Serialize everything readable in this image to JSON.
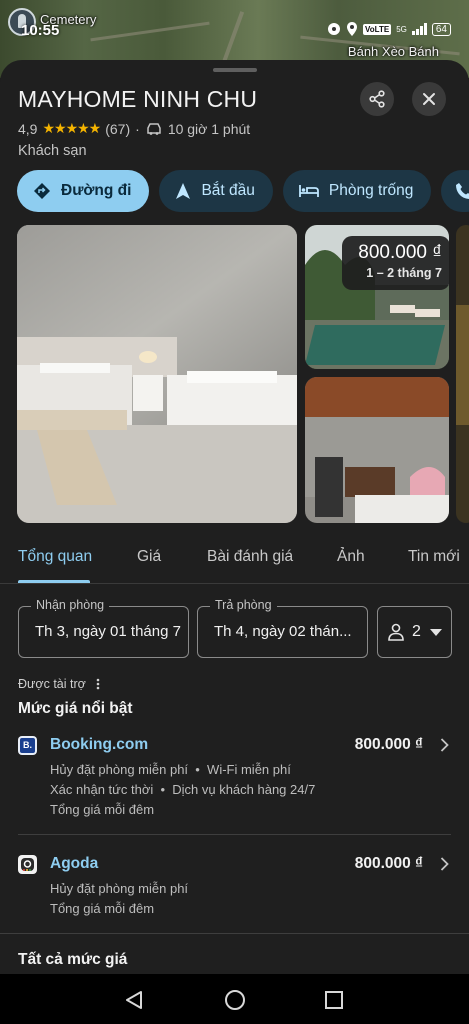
{
  "status": {
    "time": "10:55",
    "network": "5G",
    "volte": "VoLTE",
    "battery": "64"
  },
  "map": {
    "label_left": "Cemetery",
    "label_right": "Bánh Xèo Bánh"
  },
  "place": {
    "name": "MAYHOME NINH CHU",
    "rating": "4,9",
    "stars": "★★★★★",
    "reviews": "(67)",
    "separator": "·",
    "drive_time": "10 giờ 1 phút",
    "category": "Khách sạn"
  },
  "actions": [
    {
      "label": "Đường đi",
      "icon": "directions-icon"
    },
    {
      "label": "Bắt đầu",
      "icon": "navigation-arrow-icon"
    },
    {
      "label": "Phòng trống",
      "icon": "bed-icon"
    },
    {
      "label": "",
      "icon": "phone-icon"
    }
  ],
  "photo_price": {
    "price": "800.000 ₫",
    "dates": "1 – 2 tháng 7"
  },
  "tabs": [
    "Tổng quan",
    "Giá",
    "Bài đánh giá",
    "Ảnh",
    "Tin mới"
  ],
  "booking": {
    "checkin_label": "Nhận phòng",
    "checkin_value": "Th 3, ngày 01 tháng 7",
    "checkout_label": "Trả phòng",
    "checkout_value": "Th 4, ngày 02 thán...",
    "guests": "2"
  },
  "sponsored_label": "Được tài trợ",
  "featured_header": "Mức giá nổi bật",
  "offers": [
    {
      "name": "Booking.com",
      "logo_letter": "B.",
      "price": "800.000 ₫",
      "features_1": [
        "Hủy đặt phòng miễn phí",
        "Wi-Fi miễn phí"
      ],
      "features_2": [
        "Xác nhận tức thời",
        "Dịch vụ khách hàng 24/7"
      ],
      "note": "Tổng giá mỗi đêm"
    },
    {
      "name": "Agoda",
      "price": "800.000 ₫",
      "features_1": [
        "Hủy đặt phòng miễn phí"
      ],
      "note": "Tổng giá mỗi đêm"
    }
  ],
  "all_prices_header": "Tất cả mức giá",
  "colors": {
    "accent": "#8ecdf0",
    "background": "#1f1f1f",
    "star": "#f5b400"
  }
}
